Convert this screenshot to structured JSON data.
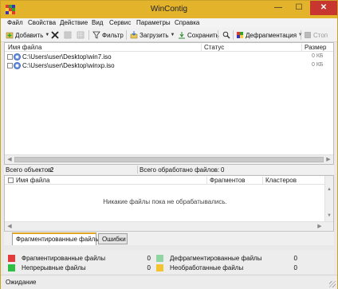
{
  "window": {
    "title": "WinContig",
    "minimize_glyph": "—",
    "maximize_glyph": "☐",
    "close_glyph": "✕",
    "app_icon": "grid-icon"
  },
  "menu": [
    "Файл",
    "Свойства",
    "Действие",
    "Вид",
    "Сервис",
    "Параметры",
    "Справка"
  ],
  "toolbar": {
    "add_label": "Добавить",
    "filter_label": "Фильтр",
    "load_label": "Загрузить",
    "save_label": "Сохранить",
    "defrag_label": "Дефрагментация",
    "stop_label": "Стоп",
    "dropdown_glyph": "▼",
    "icons": {
      "add": "add-icon",
      "remove": "remove-icon",
      "pin": "pin-icon",
      "grid": "grid-view-icon",
      "filter": "filter-icon",
      "load": "load-icon",
      "save": "save-icon",
      "search": "search-icon",
      "defrag": "defrag-icon",
      "stop": "stop-icon"
    }
  },
  "files_table": {
    "columns": {
      "name": "Имя файла",
      "status": "Статус",
      "size": "Размер"
    },
    "rows": [
      {
        "name": "C:\\Users\\user\\Desktop\\win7.iso",
        "status": "",
        "size": "0 КБ"
      },
      {
        "name": "C:\\Users\\user\\Desktop\\winxp.iso",
        "status": "",
        "size": "0 КБ"
      }
    ]
  },
  "status_counts": {
    "total_label": "Всего объектов:",
    "total_value": "2",
    "processed_label": "Всего обработано файлов:",
    "processed_value": "0"
  },
  "results_table": {
    "columns": {
      "name": "Имя файла",
      "fragments": "Фрагментов",
      "clusters": "Кластеров"
    },
    "empty_message": "Никакие файлы пока не обрабатывались."
  },
  "tabs": [
    {
      "label": "Фрагментированные файлы",
      "active": true
    },
    {
      "label": "Ошибки",
      "active": false
    }
  ],
  "legend": [
    {
      "label": "Фрагментированные файлы",
      "value": "0",
      "color": "#e53a3a"
    },
    {
      "label": "Непрерывные файлы",
      "value": "0",
      "color": "#2fbf45"
    },
    {
      "label": "Дефрагментированные файлы",
      "value": "0",
      "color": "#8fd6a3"
    },
    {
      "label": "Необработанные файлы",
      "value": "0",
      "color": "#f4c430"
    }
  ],
  "statusbar": {
    "text": "Ожидание"
  },
  "scroll": {
    "arrow_left": "◀",
    "arrow_right": "▶",
    "arrow_up": "▲",
    "arrow_down": "▼"
  },
  "colors": {
    "title_bar": "#e2b32b",
    "close_button": "#c7372f",
    "active_tab_accent": "#e1a52a"
  }
}
